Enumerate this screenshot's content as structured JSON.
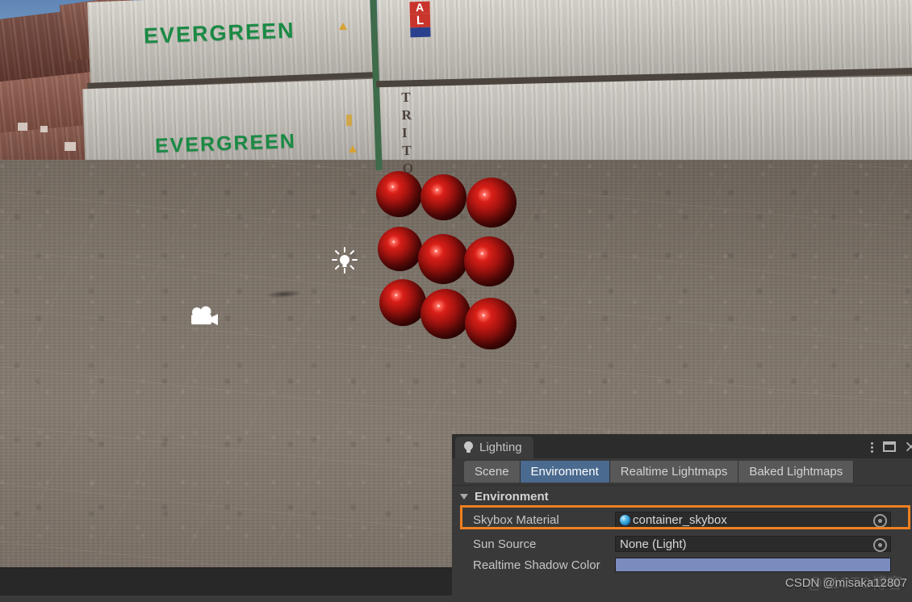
{
  "scene": {
    "name": "scene-view",
    "containers": [
      {
        "label": "EVERGREEN"
      },
      {
        "label": "EVERGREEN"
      }
    ],
    "triton_label": "TRITO",
    "logo_letters": {
      "top": "A",
      "bottom": "L"
    },
    "sphere_count": 9,
    "gizmos": [
      {
        "name": "light-gizmo",
        "type": "directional-light-icon"
      },
      {
        "name": "camera-gizmo",
        "type": "camera-icon"
      }
    ]
  },
  "panel": {
    "tab_title": "Lighting",
    "tab_icon": "lightbulb-icon",
    "header_icons": [
      {
        "name": "kebab-menu-icon",
        "glyph": "more-vertical"
      },
      {
        "name": "maximize-icon",
        "glyph": "window"
      },
      {
        "name": "close-icon",
        "glyph": "×"
      }
    ],
    "tabs": [
      {
        "label": "Scene",
        "active": false
      },
      {
        "label": "Environment",
        "active": true
      },
      {
        "label": "Realtime Lightmaps",
        "active": false
      },
      {
        "label": "Baked Lightmaps",
        "active": false
      }
    ],
    "section": {
      "title": "Environment",
      "foldout_expanded": true,
      "rows": [
        {
          "label": "Skybox Material",
          "value": "container_skybox",
          "icon": "material-preview-icon",
          "picker": "object-picker-icon",
          "highlighted": true
        },
        {
          "label": "Sun Source",
          "value": "None (Light)",
          "icon": null,
          "picker": "object-picker-icon",
          "highlighted": false
        },
        {
          "label": "Realtime Shadow Color",
          "value": "",
          "swatch": "#7b8bbd",
          "highlighted": false
        }
      ]
    },
    "highlight_color": "#f08020",
    "accent_color": "#4a6a8f"
  },
  "watermark": {
    "text": "CSDN @misaka12807"
  }
}
